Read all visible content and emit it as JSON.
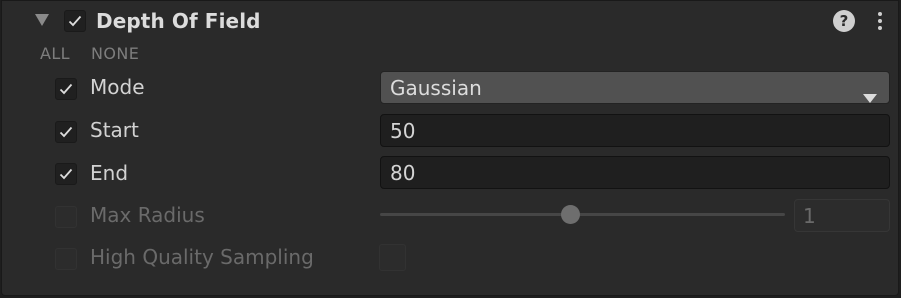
{
  "header": {
    "title": "Depth Of Field",
    "enabled": true,
    "expanded": true,
    "help_icon": "help-circle-icon",
    "menu_icon": "more-vertical-icon"
  },
  "toggles": {
    "all_label": "ALL",
    "none_label": "NONE"
  },
  "properties": {
    "mode": {
      "label": "Mode",
      "enabled": true,
      "value": "Gaussian"
    },
    "start": {
      "label": "Start",
      "enabled": true,
      "value": "50"
    },
    "end": {
      "label": "End",
      "enabled": true,
      "value": "80"
    },
    "max_radius": {
      "label": "Max Radius",
      "enabled": false,
      "value": "1",
      "slider_fraction": 0.47
    },
    "high_quality_sampling": {
      "label": "High Quality Sampling",
      "enabled": false,
      "checked": false
    }
  },
  "colors": {
    "background": "#2a2a2a",
    "field": "#1f1f1f",
    "dropdown": "#515151",
    "text": "#d2d2d2",
    "text_disabled": "#6a6a6a"
  }
}
